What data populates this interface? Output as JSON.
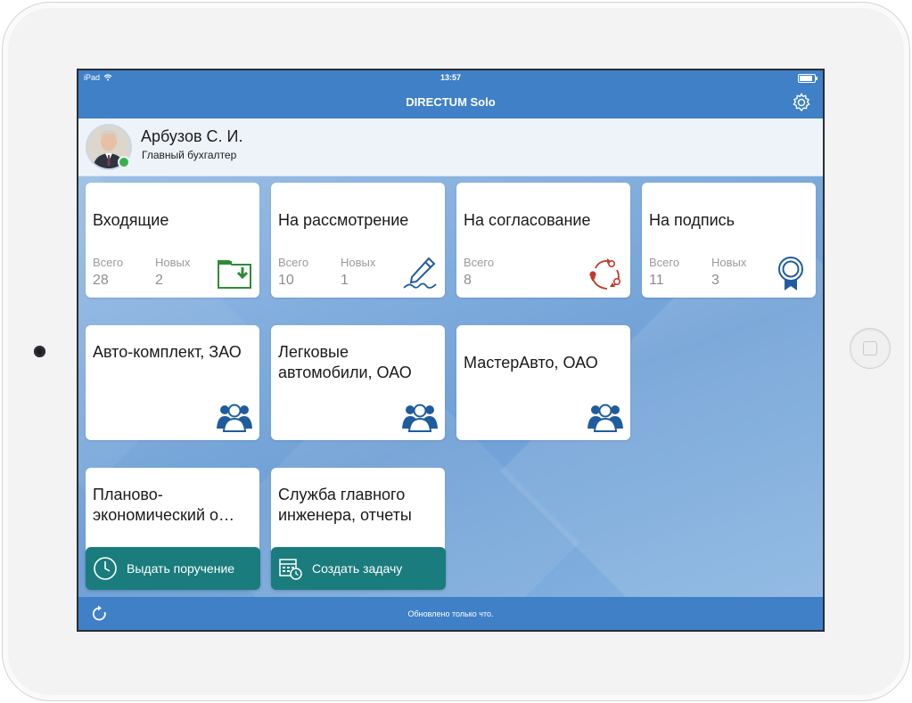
{
  "statusbar": {
    "device": "iPad",
    "time": "13:57"
  },
  "app": {
    "title": "DIRECTUM Solo"
  },
  "profile": {
    "name": "Арбузов С. И.",
    "role": "Главный бухгалтер",
    "online_status_color": "#38b24a"
  },
  "tiles_counters": [
    {
      "title": "Входящие",
      "total_label": "Всего",
      "total": "28",
      "new_label": "Новых",
      "new": "2",
      "icon": "folder-download-icon"
    },
    {
      "title": "На рассмотрение",
      "total_label": "Всего",
      "total": "10",
      "new_label": "Новых",
      "new": "1",
      "icon": "pen-icon"
    },
    {
      "title": "На согласование",
      "total_label": "Всего",
      "total": "8",
      "icon": "cycle-arrows-icon"
    },
    {
      "title": "На подпись",
      "total_label": "Всего",
      "total": "11",
      "new_label": "Новых",
      "new": "3",
      "icon": "award-ribbon-icon"
    }
  ],
  "tiles_groups": [
    {
      "title": "Авто-комплект, ЗАО",
      "icon": "group-icon"
    },
    {
      "title": "Легковые автомобили, ОАО",
      "icon": "group-icon"
    },
    {
      "title": "МастерАвто, ОАО",
      "icon": "group-icon"
    },
    {
      "title": "Планово-экономический о…",
      "icon": "group-icon"
    },
    {
      "title": "Служба главного инженера, отчеты",
      "icon": "group-icon"
    }
  ],
  "actions": {
    "assign": "Выдать поручение",
    "create_task": "Создать задачу"
  },
  "footer": {
    "status": "Обновлено только что."
  },
  "colors": {
    "accent": "#3f80c7",
    "action": "#1a7c7c",
    "folder": "#2e8b3a",
    "cycle": "#c0392b",
    "icon_blue": "#1f5c9e"
  }
}
